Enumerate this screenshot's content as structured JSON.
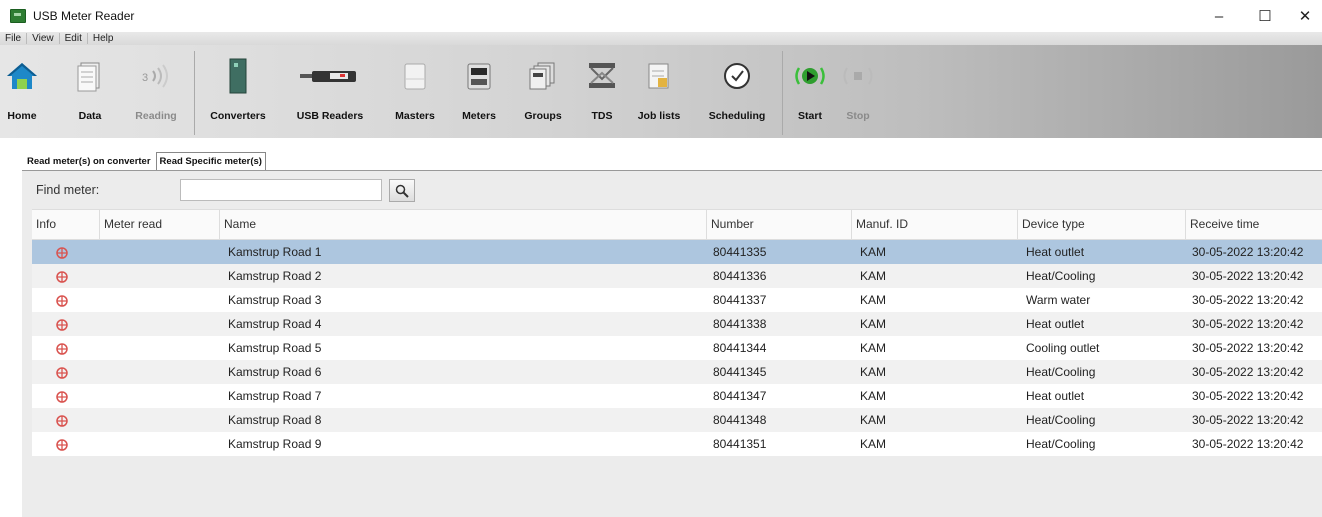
{
  "window": {
    "title": "USB Meter Reader",
    "min": "–",
    "max": "☐",
    "close": "✕"
  },
  "menu": [
    "File",
    "View",
    "Edit",
    "Help"
  ],
  "toolbar": {
    "home": "Home",
    "data": "Data",
    "reading": "Reading",
    "converters": "Converters",
    "usb_readers": "USB Readers",
    "masters": "Masters",
    "meters": "Meters",
    "groups": "Groups",
    "tds": "TDS",
    "job_lists": "Job lists",
    "scheduling": "Scheduling",
    "start": "Start",
    "stop": "Stop"
  },
  "tabs": {
    "tab1": "Read meter(s) on converter",
    "tab2": "Read Specific meter(s)"
  },
  "find": {
    "label": "Find meter:",
    "value": ""
  },
  "columns": {
    "info": "Info",
    "meter_read": "Meter read",
    "name": "Name",
    "number": "Number",
    "manuf": "Manuf. ID",
    "device": "Device type",
    "time": "Receive time"
  },
  "rows": [
    {
      "name": "Kamstrup Road 1",
      "number": "80441335",
      "manuf": "KAM",
      "device": "Heat outlet",
      "time": "30-05-2022 13:20:42"
    },
    {
      "name": "Kamstrup Road 2",
      "number": "80441336",
      "manuf": "KAM",
      "device": "Heat/Cooling",
      "time": "30-05-2022 13:20:42"
    },
    {
      "name": "Kamstrup Road 3",
      "number": "80441337",
      "manuf": "KAM",
      "device": "Warm water",
      "time": "30-05-2022 13:20:42"
    },
    {
      "name": "Kamstrup Road 4",
      "number": "80441338",
      "manuf": "KAM",
      "device": "Heat outlet",
      "time": "30-05-2022 13:20:42"
    },
    {
      "name": "Kamstrup Road 5",
      "number": "80441344",
      "manuf": "KAM",
      "device": "Cooling outlet",
      "time": "30-05-2022 13:20:42"
    },
    {
      "name": "Kamstrup Road 6",
      "number": "80441345",
      "manuf": "KAM",
      "device": "Heat/Cooling",
      "time": "30-05-2022 13:20:42"
    },
    {
      "name": "Kamstrup Road 7",
      "number": "80441347",
      "manuf": "KAM",
      "device": "Heat outlet",
      "time": "30-05-2022 13:20:42"
    },
    {
      "name": "Kamstrup Road 8",
      "number": "80441348",
      "manuf": "KAM",
      "device": "Heat/Cooling",
      "time": "30-05-2022 13:20:42"
    },
    {
      "name": "Kamstrup Road 9",
      "number": "80441351",
      "manuf": "KAM",
      "device": "Heat/Cooling",
      "time": "30-05-2022 13:20:42"
    }
  ],
  "colors": {
    "selected_row": "#adc6df",
    "info_icon": "#d9534f",
    "start_green": "#3bbf3b"
  }
}
